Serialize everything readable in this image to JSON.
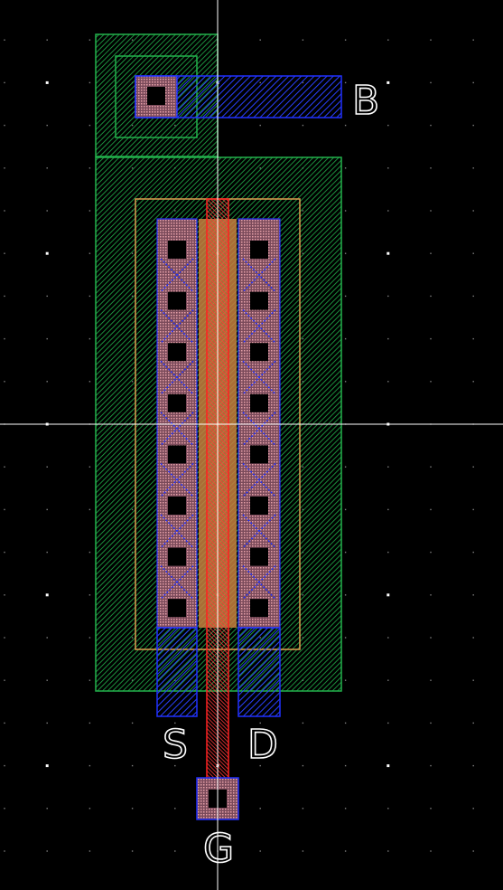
{
  "layout_view": {
    "background_color": "#000000",
    "grid_dot_color": "#7f7f7f",
    "major_grid_dot_color": "#ffffff",
    "crosshair_color": "#ffffff"
  },
  "layers": {
    "nwell": {
      "color": "#22b24c"
    },
    "implant": {
      "color": "#e0a050"
    },
    "active": {
      "color": "#22b24c"
    },
    "poly": {
      "color": "#ff2020"
    },
    "metal1": {
      "color": "#2030ff"
    },
    "contact": {
      "color": "#000000"
    },
    "diffusion": {
      "color": "#d08080"
    }
  },
  "pins": {
    "bulk": "B",
    "source": "S",
    "drain": "D",
    "gate": "G"
  },
  "contacts": {
    "source_column_count": 8,
    "drain_column_count": 8
  }
}
